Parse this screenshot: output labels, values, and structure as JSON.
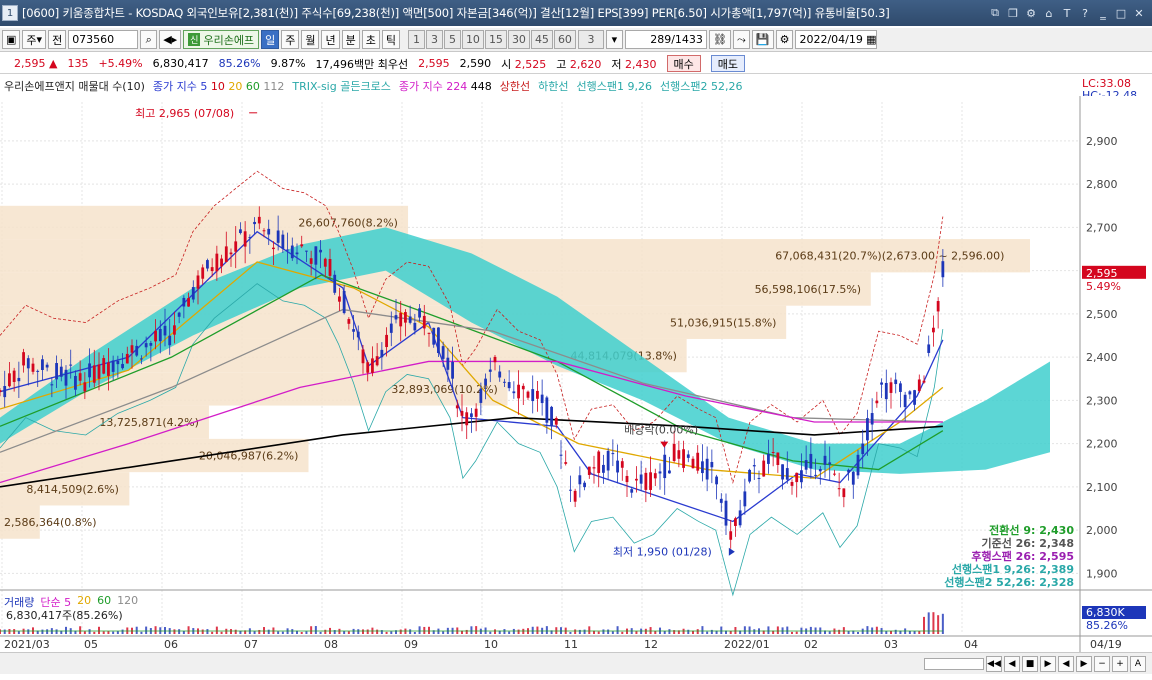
{
  "window": {
    "number": "1",
    "title": "[0600] 키움종합차트 - KOSDAQ 외국인보유[2,381(천)] 주식수[69,238(천)] 액면[500] 자본금[346(억)] 결산[12월] EPS[399] PER[6.50] 시가총액[1,797(억)] 유통비율[50.3]",
    "icons": [
      "restore-icon",
      "copy-icon",
      "settings-icon",
      "home-icon",
      "text-icon",
      "help-icon",
      "minimize-icon",
      "maximize-icon",
      "close-icon"
    ],
    "icon_glyphs": [
      "⧉",
      "❐",
      "⚙",
      "⌂",
      "T",
      "?",
      "‗",
      "□",
      "✕"
    ]
  },
  "toolbar": {
    "period_type": "주",
    "prev_label": "전",
    "code": "073560",
    "name_tag": "신",
    "name": "우리손에프",
    "periods": [
      "일",
      "주",
      "월",
      "년",
      "분",
      "초",
      "틱"
    ],
    "active_period": "일",
    "minute_steps": [
      "1",
      "3",
      "5",
      "10",
      "15",
      "30",
      "45",
      "60"
    ],
    "custom_step": "3",
    "count": "289/1433",
    "date": "2022/04/19"
  },
  "quote": {
    "price": "2,595",
    "change_arrow": "▲",
    "change": "135",
    "change_pct": "+5.49%",
    "volume": "6,830,417",
    "volume_ratio": "85.26%",
    "turnover": "9.87%",
    "amount": "17,496백만",
    "pref_label": "최우선",
    "ask": "2,595",
    "bid": "2,590",
    "open_label": "시",
    "open": "2,525",
    "high_label": "고",
    "high": "2,620",
    "low_label": "저",
    "low": "2,430",
    "buy_label": "매수",
    "sell_label": "매도"
  },
  "legend": {
    "stock": "우리손에프앤지 매물대 수(10)",
    "ma_label": "종가 지수 5",
    "ma10": "10",
    "ma20": "20",
    "ma60": "60",
    "ma112": "112",
    "trix": "TRIX-sig 골든크로스",
    "ma224": "종가 지수 224",
    "ma448": "448",
    "upper": "상한선",
    "lower": "하한선",
    "span1": "선행스팬1 9,26",
    "span2": "선행스팬2 52,26",
    "lc": "LC:33.08",
    "hc": "HC:-12.48"
  },
  "colors": {
    "candle_up": "#d4061e",
    "candle_down": "#1d36b9",
    "cloud": "#3fcfce",
    "volume_profile": "#f6e3cb",
    "ma5": "#2a3bd0",
    "ma10": "#cf0010",
    "ma20": "#e0a800",
    "ma60": "#1f9d2a",
    "ma112": "#8c8c8c",
    "ma224": "#d21dc8",
    "ma448": "#000000",
    "bollinger": "#2aa8a8",
    "envelope": "#c82020"
  },
  "chart_data": {
    "type": "candlestick",
    "title": "우리손에프앤지",
    "y_axis": {
      "min": 1880,
      "max": 2990,
      "ticks": [
        1900,
        2000,
        2100,
        2200,
        2300,
        2400,
        2500,
        2600,
        2700,
        2800,
        2900
      ],
      "tick_labels": [
        "1,900",
        "2,000",
        "2,100",
        "2,200",
        "2,300",
        "2,400",
        "2,500",
        "2,600",
        "2,700",
        "2,800",
        "2,900"
      ]
    },
    "x_axis": {
      "labels": [
        "2021/03",
        "05",
        "06",
        "07",
        "08",
        "09",
        "10",
        "11",
        "12",
        "2022/01",
        "02",
        "03",
        "04"
      ],
      "right_label": "04/19"
    },
    "current_price": {
      "value": 2595,
      "label": "2,595",
      "pct": "5.49%"
    },
    "price_path": [
      {
        "t": 0,
        "p": 2320
      },
      {
        "t": 12,
        "p": 2390
      },
      {
        "t": 25,
        "p": 2360
      },
      {
        "t": 40,
        "p": 2350
      },
      {
        "t": 55,
        "p": 2400
      },
      {
        "t": 70,
        "p": 2430
      },
      {
        "t": 82,
        "p": 2460
      },
      {
        "t": 90,
        "p": 2560
      },
      {
        "t": 100,
        "p": 2620
      },
      {
        "t": 110,
        "p": 2660
      },
      {
        "t": 120,
        "p": 2700
      },
      {
        "t": 132,
        "p": 2660
      },
      {
        "t": 142,
        "p": 2650
      },
      {
        "t": 152,
        "p": 2620
      },
      {
        "t": 158,
        "p": 2560
      },
      {
        "t": 165,
        "p": 2470
      },
      {
        "t": 172,
        "p": 2360
      },
      {
        "t": 180,
        "p": 2450
      },
      {
        "t": 190,
        "p": 2490
      },
      {
        "t": 200,
        "p": 2480
      },
      {
        "t": 210,
        "p": 2390
      },
      {
        "t": 216,
        "p": 2250
      },
      {
        "t": 222,
        "p": 2290
      },
      {
        "t": 232,
        "p": 2380
      },
      {
        "t": 242,
        "p": 2330
      },
      {
        "t": 252,
        "p": 2310
      },
      {
        "t": 260,
        "p": 2230
      },
      {
        "t": 268,
        "p": 2080
      },
      {
        "t": 276,
        "p": 2150
      },
      {
        "t": 286,
        "p": 2160
      },
      {
        "t": 296,
        "p": 2100
      },
      {
        "t": 305,
        "p": 2120
      },
      {
        "t": 316,
        "p": 2180
      },
      {
        "t": 326,
        "p": 2150
      },
      {
        "t": 334,
        "p": 2130
      },
      {
        "t": 342,
        "p": 1980
      },
      {
        "t": 350,
        "p": 2120
      },
      {
        "t": 360,
        "p": 2160
      },
      {
        "t": 372,
        "p": 2120
      },
      {
        "t": 384,
        "p": 2170
      },
      {
        "t": 392,
        "p": 2090
      },
      {
        "t": 400,
        "p": 2140
      },
      {
        "t": 410,
        "p": 2330
      },
      {
        "t": 420,
        "p": 2320
      },
      {
        "t": 428,
        "p": 2300
      },
      {
        "t": 436,
        "p": 2460
      },
      {
        "t": 440,
        "p": 2595
      }
    ],
    "moving_averages": [
      {
        "name": "5",
        "color": "#2a3bd0",
        "points": [
          {
            "t": 0,
            "p": 2320
          },
          {
            "t": 60,
            "p": 2400
          },
          {
            "t": 120,
            "p": 2690
          },
          {
            "t": 160,
            "p": 2560
          },
          {
            "t": 172,
            "p": 2380
          },
          {
            "t": 200,
            "p": 2480
          },
          {
            "t": 216,
            "p": 2260
          },
          {
            "t": 260,
            "p": 2240
          },
          {
            "t": 276,
            "p": 2130
          },
          {
            "t": 342,
            "p": 2020
          },
          {
            "t": 372,
            "p": 2130
          },
          {
            "t": 392,
            "p": 2110
          },
          {
            "t": 428,
            "p": 2310
          },
          {
            "t": 440,
            "p": 2440
          }
        ]
      },
      {
        "name": "20",
        "color": "#e0a800",
        "points": [
          {
            "t": 0,
            "p": 2280
          },
          {
            "t": 60,
            "p": 2370
          },
          {
            "t": 120,
            "p": 2620
          },
          {
            "t": 165,
            "p": 2560
          },
          {
            "t": 200,
            "p": 2470
          },
          {
            "t": 230,
            "p": 2300
          },
          {
            "t": 270,
            "p": 2200
          },
          {
            "t": 330,
            "p": 2140
          },
          {
            "t": 380,
            "p": 2120
          },
          {
            "t": 420,
            "p": 2250
          },
          {
            "t": 440,
            "p": 2330
          }
        ]
      },
      {
        "name": "60",
        "color": "#1f9d2a",
        "points": [
          {
            "t": 0,
            "p": 2240
          },
          {
            "t": 80,
            "p": 2400
          },
          {
            "t": 150,
            "p": 2590
          },
          {
            "t": 200,
            "p": 2500
          },
          {
            "t": 260,
            "p": 2390
          },
          {
            "t": 320,
            "p": 2230
          },
          {
            "t": 370,
            "p": 2160
          },
          {
            "t": 410,
            "p": 2140
          },
          {
            "t": 440,
            "p": 2230
          }
        ]
      },
      {
        "name": "112",
        "color": "#8c8c8c",
        "points": [
          {
            "t": 0,
            "p": 2180
          },
          {
            "t": 80,
            "p": 2330
          },
          {
            "t": 160,
            "p": 2510
          },
          {
            "t": 230,
            "p": 2460
          },
          {
            "t": 300,
            "p": 2340
          },
          {
            "t": 370,
            "p": 2260
          },
          {
            "t": 440,
            "p": 2250
          }
        ]
      },
      {
        "name": "224",
        "color": "#d21dc8",
        "points": [
          {
            "t": 0,
            "p": 2110
          },
          {
            "t": 60,
            "p": 2200
          },
          {
            "t": 140,
            "p": 2330
          },
          {
            "t": 200,
            "p": 2390
          },
          {
            "t": 260,
            "p": 2390
          },
          {
            "t": 320,
            "p": 2310
          },
          {
            "t": 380,
            "p": 2250
          },
          {
            "t": 440,
            "p": 2250
          }
        ]
      },
      {
        "name": "448",
        "color": "#000000",
        "points": [
          {
            "t": 0,
            "p": 2100
          },
          {
            "t": 80,
            "p": 2160
          },
          {
            "t": 160,
            "p": 2220
          },
          {
            "t": 240,
            "p": 2260
          },
          {
            "t": 320,
            "p": 2240
          },
          {
            "t": 380,
            "p": 2220
          },
          {
            "t": 440,
            "p": 2240
          }
        ]
      }
    ],
    "cloud_band": [
      {
        "t": 0,
        "a": 2200,
        "b": 2260
      },
      {
        "t": 40,
        "a": 2320,
        "b": 2400
      },
      {
        "t": 90,
        "a": 2450,
        "b": 2560
      },
      {
        "t": 140,
        "a": 2560,
        "b": 2660
      },
      {
        "t": 180,
        "a": 2600,
        "b": 2700
      },
      {
        "t": 220,
        "a": 2480,
        "b": 2640
      },
      {
        "t": 260,
        "a": 2380,
        "b": 2540
      },
      {
        "t": 300,
        "a": 2300,
        "b": 2400
      },
      {
        "t": 340,
        "a": 2200,
        "b": 2260
      },
      {
        "t": 380,
        "a": 2140,
        "b": 2200
      },
      {
        "t": 420,
        "a": 2130,
        "b": 2200
      },
      {
        "t": 460,
        "a": 2140,
        "b": 2300
      },
      {
        "t": 490,
        "a": 2180,
        "b": 2390
      }
    ],
    "volume_profile": [
      {
        "label": "67,068,431(20.7%)(2,673.00 ~ 2,596.00)",
        "from": 2596,
        "to": 2673,
        "pct": 20.7
      },
      {
        "label": "56,598,106(17.5%)",
        "from": 2519,
        "to": 2596,
        "pct": 17.5
      },
      {
        "label": "51,036,915(15.8%)",
        "from": 2442,
        "to": 2519,
        "pct": 15.8
      },
      {
        "label": "44,814,079(13.8%)",
        "from": 2365,
        "to": 2442,
        "pct": 13.8
      },
      {
        "label": "32,893,069(10.2%)",
        "from": 2288,
        "to": 2365,
        "pct": 10.2
      },
      {
        "label": "26,607,760(8.2%)",
        "from": 2673,
        "to": 2750,
        "pct": 8.2
      },
      {
        "label": "20,046,987(6.2%)",
        "from": 2134,
        "to": 2211,
        "pct": 6.2
      },
      {
        "label": "13,725,871(4.2%)",
        "from": 2211,
        "to": 2288,
        "pct": 4.2
      },
      {
        "label": "8,414,509(2.6%)",
        "from": 2057,
        "to": 2134,
        "pct": 2.6
      },
      {
        "label": "2,586,364(0.8%)",
        "from": 1980,
        "to": 2057,
        "pct": 0.8
      }
    ],
    "annotations": {
      "high": "최고 2,965 (07/08)",
      "low": "최저 1,950 (01/28)",
      "dividend": "배당락(0.00%)"
    },
    "ichimoku_values": [
      {
        "label": "전환선 9: 2,430",
        "color": "#1f9d2a"
      },
      {
        "label": "기준선 26: 2,348",
        "color": "#555555"
      },
      {
        "label": "후행스팬 26: 2,595",
        "color": "#9a1fb0"
      },
      {
        "label": "선행스팬1 9,26: 2,389",
        "color": "#2aa8a8"
      },
      {
        "label": "선행스팬2 52,26: 2,328",
        "color": "#2aa8a8"
      }
    ],
    "volume": {
      "legend": [
        "거래량",
        "단순 5",
        "20",
        "60",
        "120"
      ],
      "legend_colors": [
        "#1d36b9",
        "#d21dc8",
        "#e0a800",
        "#1f9d2a",
        "#8c8c8c"
      ],
      "current": "6,830,417주(85.26%)",
      "axis_label": "6,830K",
      "axis_pct": "85.26%"
    }
  },
  "bottombar": {
    "buttons": [
      "◀◀",
      "◀",
      "■",
      "▶",
      "◀",
      "▶",
      "−",
      "+",
      "A"
    ]
  }
}
